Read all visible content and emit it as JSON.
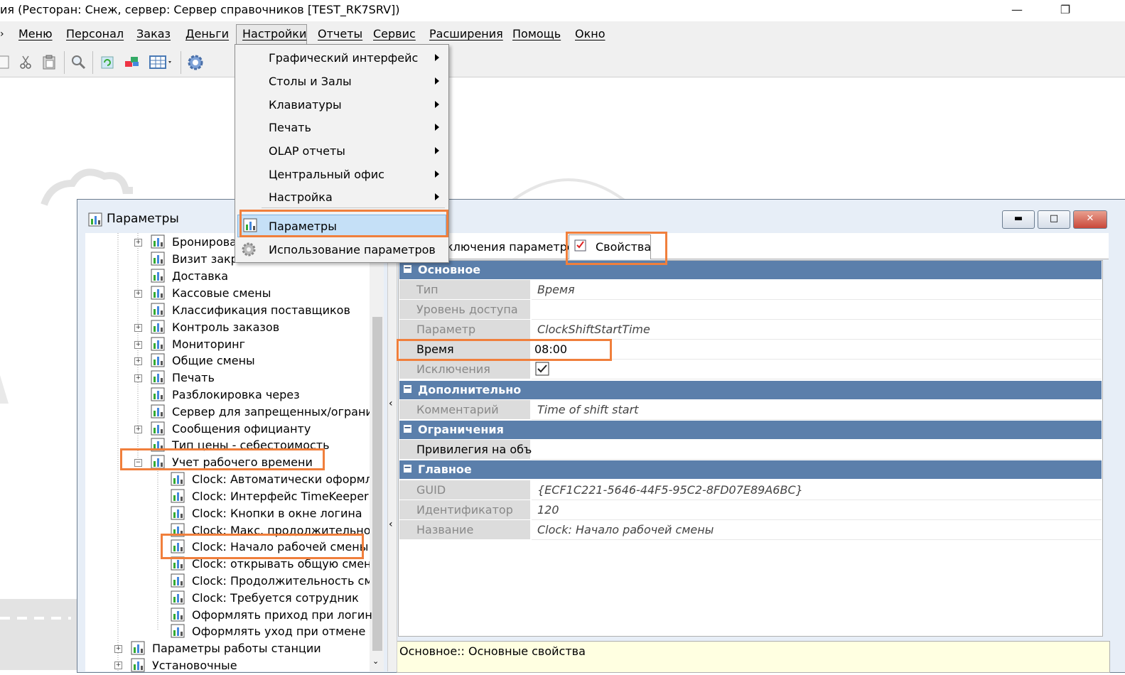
{
  "window": {
    "title": "ия (Ресторан: Снеж, сервер: Сервер справочников [TEST_RK7SRV])"
  },
  "menubar": {
    "items": [
      "Меню",
      "Персонал",
      "Заказ",
      "Деньги",
      "Настройки",
      "Отчеты",
      "Сервис",
      "Расширения",
      "Помощь",
      "Окно"
    ]
  },
  "toolbar": {
    "icons": [
      "page-icon",
      "cut-icon",
      "paste-icon",
      "search-icon",
      "refresh-icon",
      "transfer-icon",
      "grid-icon",
      "gear-icon"
    ]
  },
  "dropdown": {
    "items": [
      {
        "label": "Графический интерфейс",
        "submenu": true
      },
      {
        "label": "Столы и Залы",
        "submenu": true
      },
      {
        "label": "Клавиатуры",
        "submenu": true
      },
      {
        "label": "Печать",
        "submenu": true
      },
      {
        "label": "OLAP отчеты",
        "submenu": true
      },
      {
        "label": "Центральный офис",
        "submenu": true
      },
      {
        "label": "Настройка",
        "submenu": true
      },
      {
        "label": "Параметры",
        "submenu": false
      },
      {
        "label": "Использование параметров",
        "submenu": false
      }
    ]
  },
  "params_window": {
    "title": "Параметры",
    "tree": [
      "Бронирован",
      "Визит закр",
      "Доставка",
      "Кассовые смены",
      "Классификация поставщиков",
      "Контроль заказов",
      "Мониторинг",
      "Общие смены",
      "Печать",
      "Разблокировка через",
      "Сервер для запрещенных/ограничен",
      "Сообщения официанту",
      "Тип цены - себестоимость",
      "Учет рабочего времени",
      "Clock: Автоматически оформлять",
      "Clock: Интерфейс TimeKeeper",
      "Clock: Кнопки в окне логина",
      "Clock: Макс. продолжительность",
      "Clock: Начало рабочей смены",
      "Clock: открывать общую смену п",
      "Clock: Продолжительность смен",
      "Clock: Требуется сотрудник",
      "Оформлять приход при логине",
      "Оформлять уход при отмене реги",
      "Параметры работы станции",
      "Установочные"
    ],
    "tabs": {
      "usage": "ключения параметров",
      "properties": "Свойства"
    },
    "categories": {
      "main": "Основное",
      "extra": "Дополнительно",
      "limits": "Ограничения",
      "general": "Главное"
    },
    "props": {
      "type": {
        "name": "Тип",
        "value": "Время"
      },
      "access": {
        "name": "Уровень доступа",
        "value": ""
      },
      "param": {
        "name": "Параметр",
        "value": "ClockShiftStartTime"
      },
      "time": {
        "name": "Время",
        "value": "08:00"
      },
      "exceptions": {
        "name": "Исключения",
        "checked": true
      },
      "comment": {
        "name": "Комментарий",
        "value": "Time of shift start"
      },
      "privilege": {
        "name": "Привилегия на объе",
        "value": ""
      },
      "guid": {
        "name": "GUID",
        "value": "{ECF1C221-5646-44F5-95C2-8FD07E89A6BC}"
      },
      "ident": {
        "name": "Идентификатор",
        "value": "120"
      },
      "name": {
        "name": "Название",
        "value": "Clock: Начало рабочей смены"
      }
    },
    "description": "Основное:: Основные свойства"
  },
  "colors": {
    "highlight": "#f07f3c",
    "category": "#5b7fab",
    "menu_selected": "#c5e0f7"
  }
}
